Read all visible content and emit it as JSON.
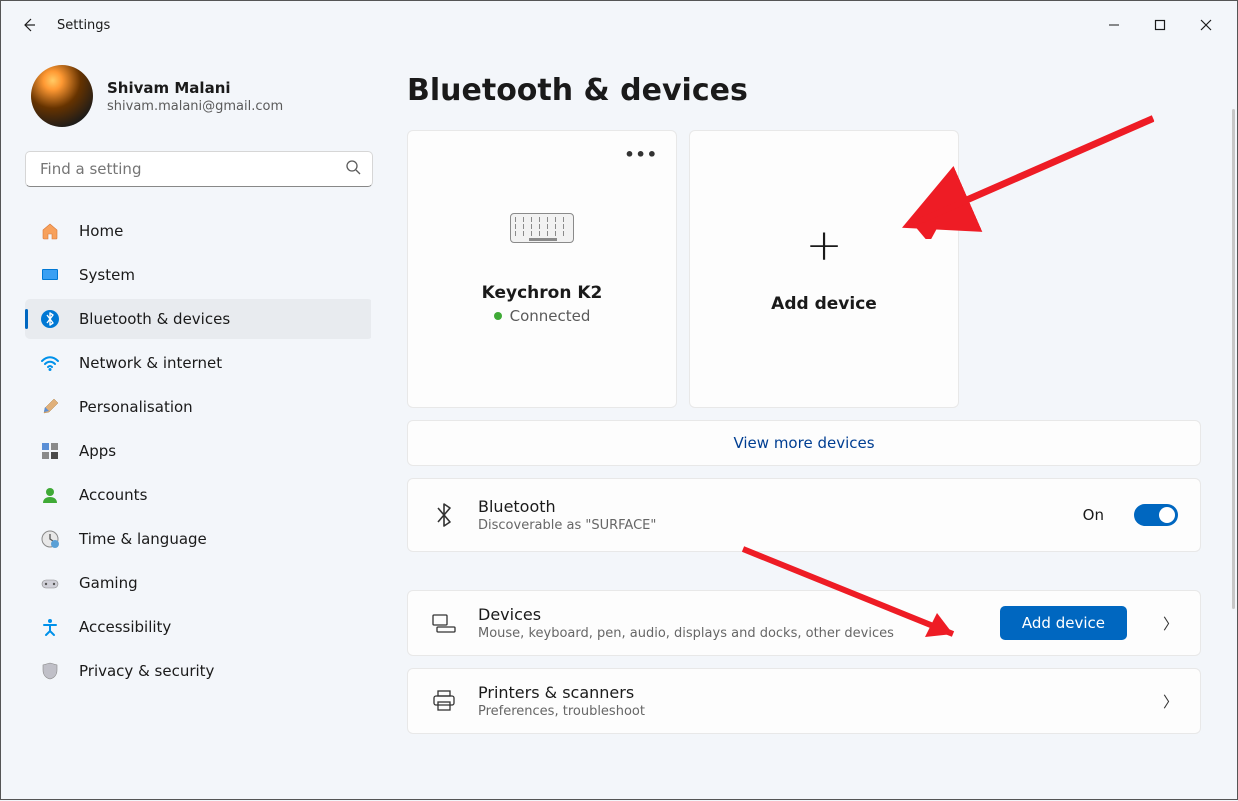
{
  "app": {
    "title": "Settings"
  },
  "profile": {
    "name": "Shivam Malani",
    "email": "shivam.malani@gmail.com"
  },
  "search": {
    "placeholder": "Find a setting"
  },
  "nav": {
    "items": [
      {
        "label": "Home"
      },
      {
        "label": "System"
      },
      {
        "label": "Bluetooth & devices"
      },
      {
        "label": "Network & internet"
      },
      {
        "label": "Personalisation"
      },
      {
        "label": "Apps"
      },
      {
        "label": "Accounts"
      },
      {
        "label": "Time & language"
      },
      {
        "label": "Gaming"
      },
      {
        "label": "Accessibility"
      },
      {
        "label": "Privacy & security"
      }
    ],
    "activeIndex": 2
  },
  "page": {
    "title": "Bluetooth & devices",
    "deviceCard": {
      "name": "Keychron K2",
      "status": "Connected"
    },
    "addCard": {
      "label": "Add device"
    },
    "viewMore": "View more devices",
    "bluetoothRow": {
      "title": "Bluetooth",
      "subtitle": "Discoverable as \"SURFACE\"",
      "toggleLabel": "On"
    },
    "devicesRow": {
      "title": "Devices",
      "subtitle": "Mouse, keyboard, pen, audio, displays and docks, other devices",
      "button": "Add device"
    },
    "printersRow": {
      "title": "Printers & scanners",
      "subtitle": "Preferences, troubleshoot"
    }
  }
}
